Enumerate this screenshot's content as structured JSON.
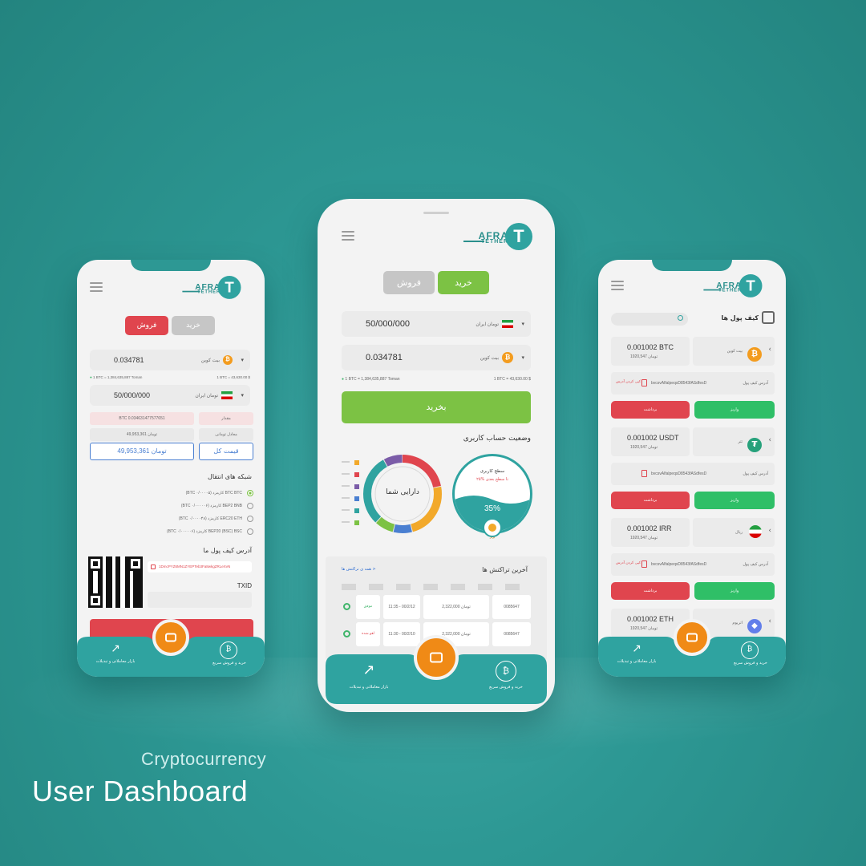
{
  "caption": {
    "line1": "Cryptocurrency",
    "line2": "User Dashboard"
  },
  "brand": {
    "name1": "AFRA",
    "name2": "TETHER",
    "mark": "T"
  },
  "colors": {
    "teal": "#2fa3a0",
    "green": "#7cc244",
    "red": "#e0454e",
    "orange": "#f08a16"
  },
  "left_phone": {
    "sell_label": "فروش",
    "buy_label": "خرید",
    "btc_amount": "0.034781",
    "btc_name": "بیت کوین",
    "rate_left": "1 BTC = 1,384,635,887 Toman",
    "rate_right": "1 BTC = 43,630.00 $",
    "toman_amount": "50/000/000",
    "toman_name": "تومان ایران",
    "row1_value": "BTC 0.034631477577651",
    "row1_label": "مقدار",
    "row2_value": "49,953,361 تومان",
    "row2_label": "معادل تومانی",
    "total_value": "49,953,361 تومان",
    "total_label": "قیمت کل",
    "network_title": "شبکه های انتقال",
    "networks": [
      "BTC BTC کارمزد (۰/۰۰۰۰۵ BTC)",
      "BEP2 BNB کارمزد (۰/۰۰۰۰۰۶ BTC)",
      "ERC20 ETH کارمزد (۰/۰۰۰۰۴۸ BTC)",
      "BEP20 (BSC) BSC کارمزد (۰/۰۰۰۰۰۶ BTC)"
    ],
    "wallet_title": "آدرس کیف پول ما",
    "wallet_address": "1DmcPYZ6MN1ZYEPTeb3Fa8wkgZRLeXvN",
    "txid_label": "TXID",
    "nav_left": "بازار معاملاتی و تبدیلات",
    "nav_right": "خرید و فروش سریع"
  },
  "center_phone": {
    "sell_label": "فروش",
    "buy_label": "خرید",
    "toman_amount": "50/000/000",
    "toman_name": "تومان ایران",
    "btc_amount": "0.034781",
    "btc_name": "بیت کوین",
    "rate_left": "1 BTC = 1,384,635,887 Toman",
    "rate_right": "1 BTC = 43,630.00 $",
    "submit_label": "بخرید",
    "status_title": "وضعیت حساب کاربری",
    "assets_label": "دارایی شما",
    "level_title": "سطح کاربری",
    "level_note": "۲۵% تا سطح بعدی",
    "level_percent": "35%",
    "level_badge": "برنز",
    "donut_segments": [
      {
        "value": 22,
        "color": "#e0454e"
      },
      {
        "value": 24,
        "color": "#f2a92b"
      },
      {
        "value": 8,
        "color": "#4a7fd1"
      },
      {
        "value": 8,
        "color": "#7cc244"
      },
      {
        "value": 30,
        "color": "#2fa3a0"
      },
      {
        "value": 8,
        "color": "#7b5ca8"
      }
    ],
    "legend_colors": [
      "#f2a92b",
      "#e0454e",
      "#7b5ca8",
      "#4a7fd1",
      "#2fa3a0",
      "#7cc244"
    ],
    "tx_title": "آخرین تراکنش ها",
    "tx_link": "همه ی تراکنش ها >",
    "tx_rows": [
      {
        "id": "0085647",
        "amount": "2,322,000 تومان",
        "date": "11:35 - 00/2/12",
        "status": "موفق",
        "status_color": "#3fb56a"
      },
      {
        "id": "0085647",
        "amount": "2,322,000 تومان",
        "date": "11:30 - 00/2/10",
        "status": "لغو شده",
        "status_color": "#e0454e"
      }
    ],
    "nav_left": "بازار معاملاتی و تبدیلات",
    "nav_right": "خرید و فروش سریع"
  },
  "right_phone": {
    "title": "کیف پول ها",
    "wallets": [
      {
        "amount": "0.001002 BTC",
        "toman": "1920,547 تومان",
        "name": "بیت کوین",
        "coin": "btc",
        "address": "bvcsvAlfalpeqsD8543fASdfesD",
        "address_label": "آدرس کیف پول",
        "copy": "کپی کردن آدرس",
        "withdraw": "برداشت",
        "deposit": "واریز"
      },
      {
        "amount": "0.001002 USDT",
        "toman": "1920,547 تومان",
        "name": "تتر",
        "coin": "usdt",
        "address": "bvcsvAlfalpeqsD8543fASdfesD",
        "address_label": "آدرس کیف پول",
        "copy": "",
        "withdraw": "برداشت",
        "deposit": "واریز"
      },
      {
        "amount": "0.001002 IRR",
        "toman": "1920,547 تومان",
        "name": "ریال",
        "coin": "irr",
        "address": "bvcsvAlfalpeqsD8543fASdfesD",
        "address_label": "آدرس کیف پول",
        "copy": "کپی کردن آدرس",
        "withdraw": "برداشت",
        "deposit": "واریز"
      },
      {
        "amount": "0.001002 ETH",
        "toman": "1920,547 تومان",
        "name": "اتریوم",
        "coin": "eth",
        "address": "",
        "address_label": "",
        "copy": "",
        "withdraw": "",
        "deposit": ""
      }
    ],
    "nav_left": "بازار معاملاتی و تبدیلات",
    "nav_right": "خرید و فروش سریع"
  }
}
